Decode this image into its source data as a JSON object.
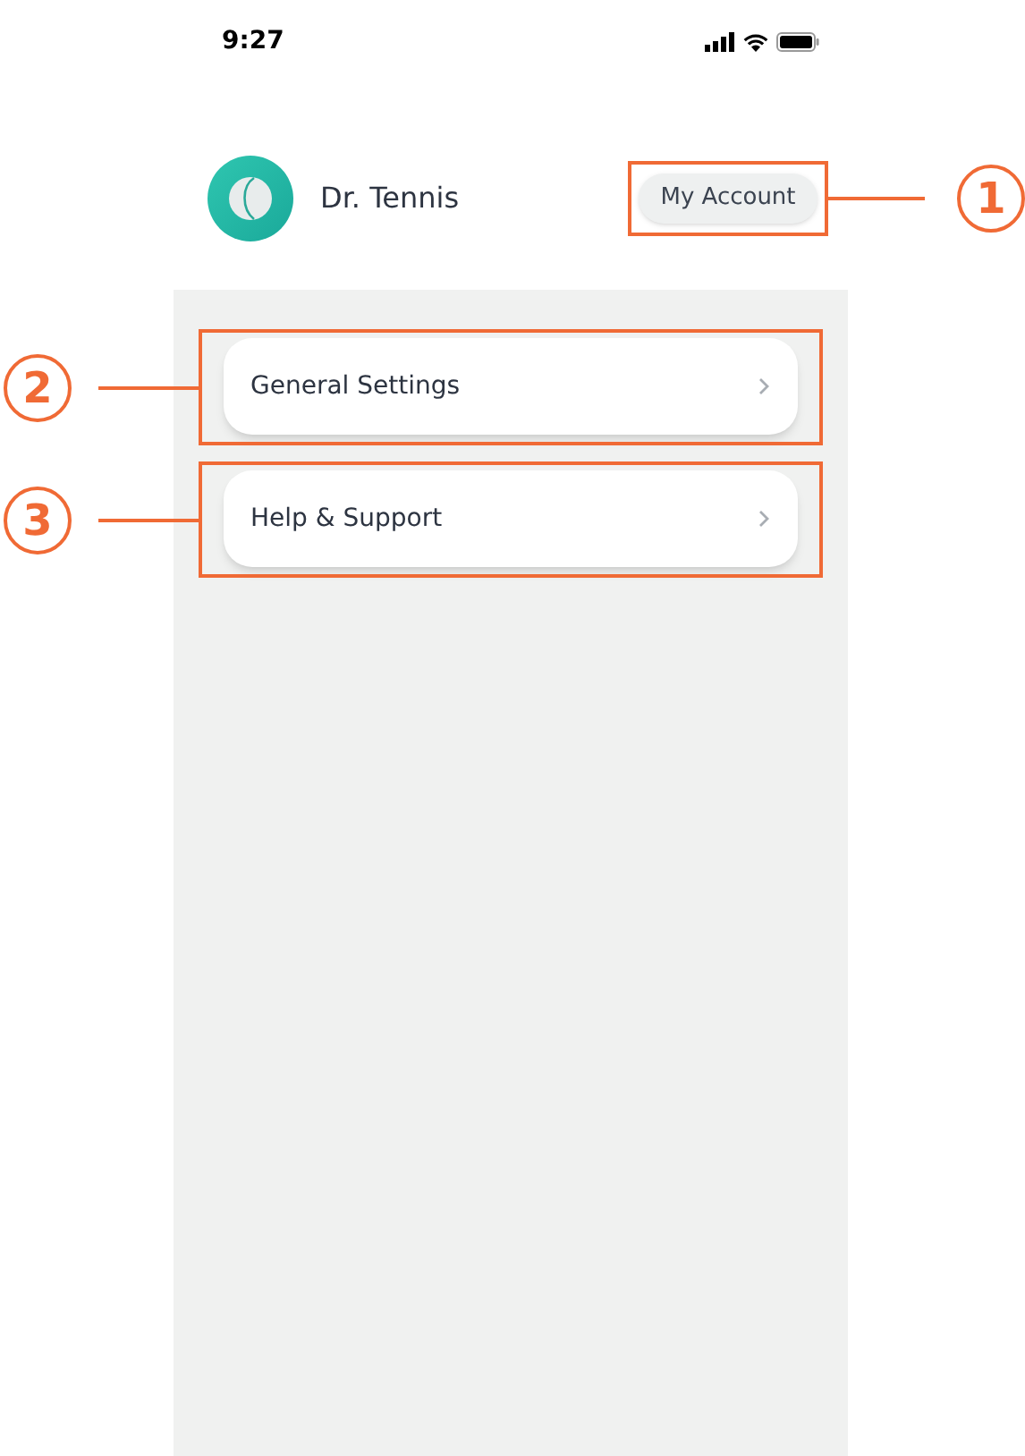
{
  "status_bar": {
    "time": "9:27"
  },
  "header": {
    "name": "Dr. Tennis",
    "account_button": {
      "label": "My Account",
      "callout": "1"
    }
  },
  "menu": [
    {
      "label": "General Settings",
      "callout": "2"
    },
    {
      "label": "Help & Support",
      "callout": "3"
    }
  ]
}
